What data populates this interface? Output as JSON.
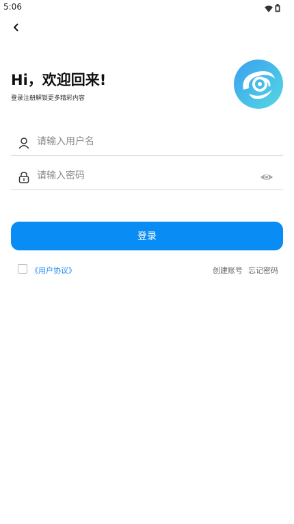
{
  "status_bar": {
    "time": "5:06",
    "icons": [
      "wifi-icon",
      "battery-icon"
    ]
  },
  "header": {
    "back_icon": "chevron-left-icon"
  },
  "welcome": {
    "title": "Hi，欢迎回来!",
    "subtitle": "登录注册解锁更多精彩内容"
  },
  "logo": {
    "icon": "app-logo-icon",
    "colors": [
      "#3fa4f0",
      "#52d4e4"
    ]
  },
  "form": {
    "username": {
      "icon": "user-icon",
      "placeholder": "请输入用户名",
      "value": ""
    },
    "password": {
      "icon": "lock-icon",
      "placeholder": "请输入密码",
      "value": "",
      "visibility_icon": "eye-icon"
    },
    "login_label": "登录"
  },
  "footer": {
    "agreement_checked": false,
    "agreement_link": "《用户协议》",
    "create_account": "创建账号",
    "forgot_password": "忘记密码"
  },
  "colors": {
    "accent": "#0a8cf5",
    "link": "#1a8cf0",
    "muted": "#666666"
  }
}
